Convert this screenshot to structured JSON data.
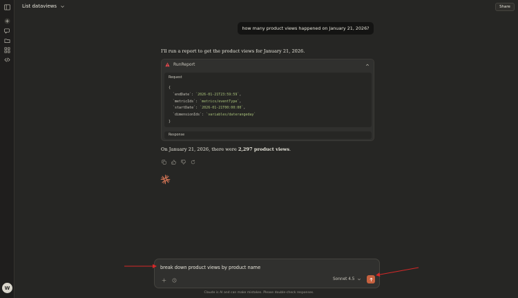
{
  "header": {
    "title": "List dataviews",
    "share_label": "Share"
  },
  "sidebar": {
    "icons": [
      "sidebar-toggle-icon",
      "plus-icon",
      "chat-bubbles-icon",
      "folder-icon",
      "grid-icon",
      "code-icon"
    ],
    "avatar_initial": "W"
  },
  "conversation": {
    "user_message": "how many product views happened on January 21, 2026?",
    "assistant_intro": "I'll run a report to get the product views for January 21, 2026.",
    "tool": {
      "name": "RunReport",
      "request_label": "Request",
      "response_label": "Response",
      "code": {
        "open": "{",
        "line1_key": "  `endDate`: ",
        "line1_val": "`2026-01-21T23:59:59`",
        "line1_end": ",",
        "line2_key": "  `metricIds`: ",
        "line2_val": "`metrics/eventType`",
        "line2_end": ",",
        "line3_key": "  `startDate`: ",
        "line3_val": "`2026-01-21T00:00:00`",
        "line3_end": ",",
        "line4_key": "  `dimensionIds`: ",
        "line4_val": "`variables/daterangeday`",
        "close": "}"
      }
    },
    "answer_prefix": "On January 21, 2026, there were ",
    "answer_bold": "2,297 product views",
    "answer_suffix": "."
  },
  "composer": {
    "input_value": "break down product views by product name",
    "model": "Sonnet 4.5"
  },
  "disclaimer": "Claude is AI and can make mistakes. Please double-check responses.",
  "colors": {
    "background": "#262624",
    "send_button": "#c6613f",
    "annotation_arrow": "#d62828",
    "warning": "#e5484d"
  }
}
